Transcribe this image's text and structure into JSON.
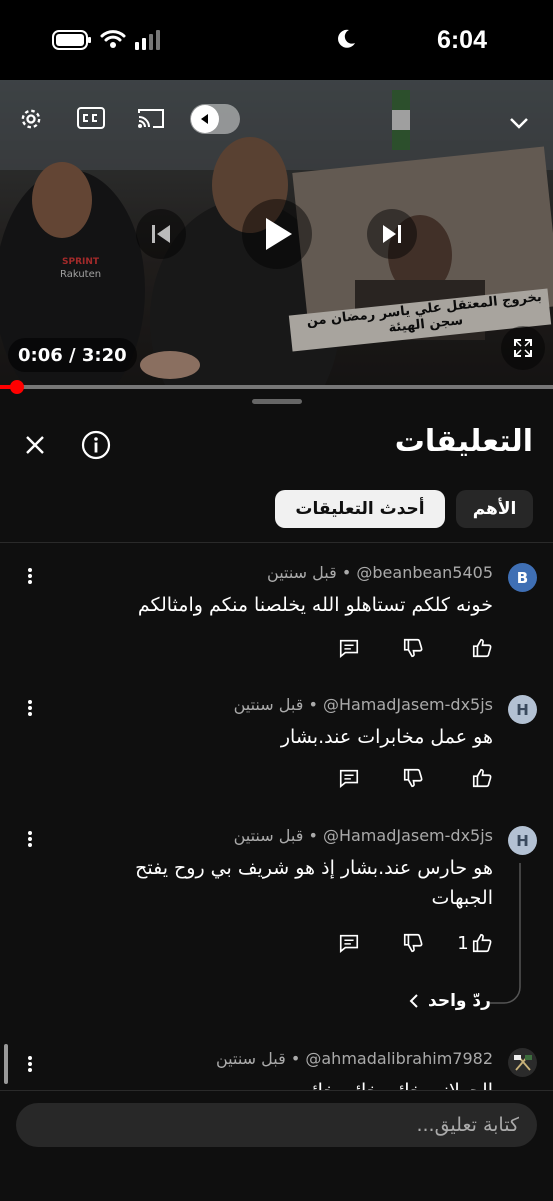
{
  "status_bar": {
    "time": "6:04"
  },
  "player": {
    "time_display": "0:06 / 3:20",
    "progress": 0.03,
    "sign_text": "بخروج المعتقل علي ياسر رمضان من سجن الهيئة",
    "shirt_brand": "SPRINT",
    "shirt_sponsor": "Rakuten"
  },
  "sheet": {
    "title": "التعليقات",
    "chips": [
      {
        "label": "الأهم"
      },
      {
        "label": "أحدث التعليقات",
        "selected": true
      }
    ]
  },
  "comments": [
    {
      "avatar": "B",
      "avatar_color": "#3f6fb4",
      "handle": "@beanbean5405",
      "age": "قبل سنتين",
      "text": "خونه كلكم تستاهلو الله يخلصنا منكم وامثالكم",
      "likes": ""
    },
    {
      "avatar": "H",
      "avatar_color": "#b3c1d3",
      "handle": "@HamadJasem-dx5js",
      "age": "قبل سنتين",
      "text": "هو عمل مخابرات عند.بشار",
      "likes": ""
    },
    {
      "avatar": "H",
      "avatar_color": "#b3c1d3",
      "handle": "@HamadJasem-dx5js",
      "age": "قبل سنتين",
      "text": "هو حارس عند.بشار إذ هو شريف بي روح يفتح الجبهات",
      "likes": "1",
      "replies": "ردّ واحد"
    },
    {
      "avatar": "",
      "avatar_color": "#2b2b2b",
      "handle": "@ahmadalibrahim7982",
      "age": "قبل سنتين",
      "text": "الجولاني خائن خائن خائن",
      "likes": ""
    }
  ],
  "separator": "•",
  "composer": {
    "placeholder": "كتابة تعليق..."
  }
}
